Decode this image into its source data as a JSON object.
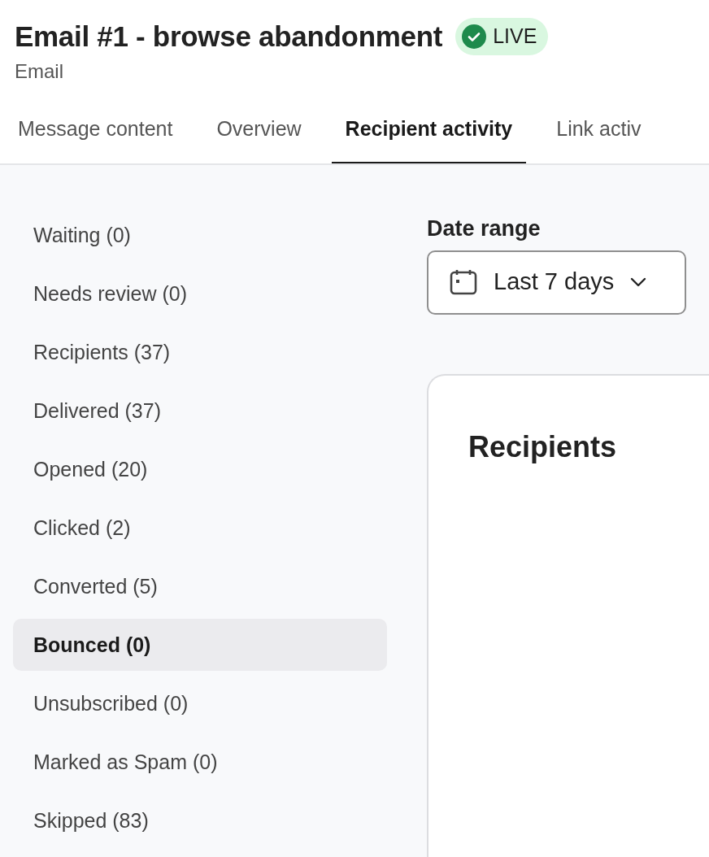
{
  "header": {
    "title": "Email #1 - browse abandonment",
    "status": {
      "label": "LIVE",
      "live": true
    },
    "subtitle": "Email"
  },
  "tabs": [
    {
      "label": "Message content",
      "selected": false
    },
    {
      "label": "Overview",
      "selected": false
    },
    {
      "label": "Recipient activity",
      "selected": true
    },
    {
      "label": "Link activ",
      "selected": false
    }
  ],
  "sidebar": {
    "items": [
      {
        "label": "Waiting (0)",
        "selected": false
      },
      {
        "label": "Needs review (0)",
        "selected": false
      },
      {
        "label": "Recipients (37)",
        "selected": false
      },
      {
        "label": "Delivered (37)",
        "selected": false
      },
      {
        "label": "Opened (20)",
        "selected": false
      },
      {
        "label": "Clicked (2)",
        "selected": false
      },
      {
        "label": "Converted (5)",
        "selected": false
      },
      {
        "label": "Bounced (0)",
        "selected": true
      },
      {
        "label": "Unsubscribed (0)",
        "selected": false
      },
      {
        "label": "Marked as Spam (0)",
        "selected": false
      },
      {
        "label": "Skipped (83)",
        "selected": false
      }
    ]
  },
  "date_range": {
    "label": "Date range",
    "value": "Last 7 days"
  },
  "panel": {
    "title": "Recipients"
  }
}
